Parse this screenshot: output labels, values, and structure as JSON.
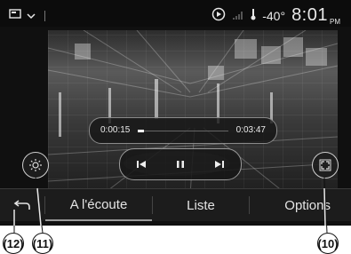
{
  "status_bar": {
    "temperature": "-40°",
    "time": "8:01",
    "ampm": "PM"
  },
  "player": {
    "elapsed": "0:00:15",
    "total": "0:03:47",
    "progress_fraction": 0.07
  },
  "tabs": [
    {
      "label": "A l'écoute",
      "active": true
    },
    {
      "label": "Liste",
      "active": false
    },
    {
      "label": "Options",
      "active": false
    }
  ],
  "callouts": [
    "(12)",
    "(11)",
    "(10)"
  ],
  "colors": {
    "screen_bg": "#101010",
    "tabbar_bg": "#1c1c1c",
    "text": "#e4e4e4"
  }
}
